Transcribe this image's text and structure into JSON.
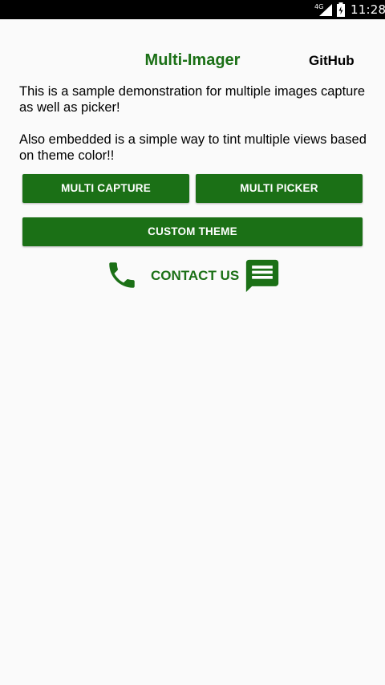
{
  "status_bar": {
    "network": "4G",
    "time": "11:28"
  },
  "header": {
    "title": "Multi-Imager",
    "github_label": "GitHub"
  },
  "description": {
    "paragraph_1": "This is a sample demonstration for multiple images capture as well as picker!",
    "paragraph_2": "Also embedded is a simple way to tint multiple views based on theme color!!"
  },
  "buttons": {
    "multi_capture": "MULTI CAPTURE",
    "multi_picker": "MULTI PICKER",
    "custom_theme": "CUSTOM THEME"
  },
  "contact": {
    "label": "CONTACT US",
    "phone_icon": "phone-icon",
    "chat_icon": "chat-icon"
  },
  "colors": {
    "accent": "#1b7016",
    "background": "#fafafa",
    "status_bar": "#000000"
  }
}
